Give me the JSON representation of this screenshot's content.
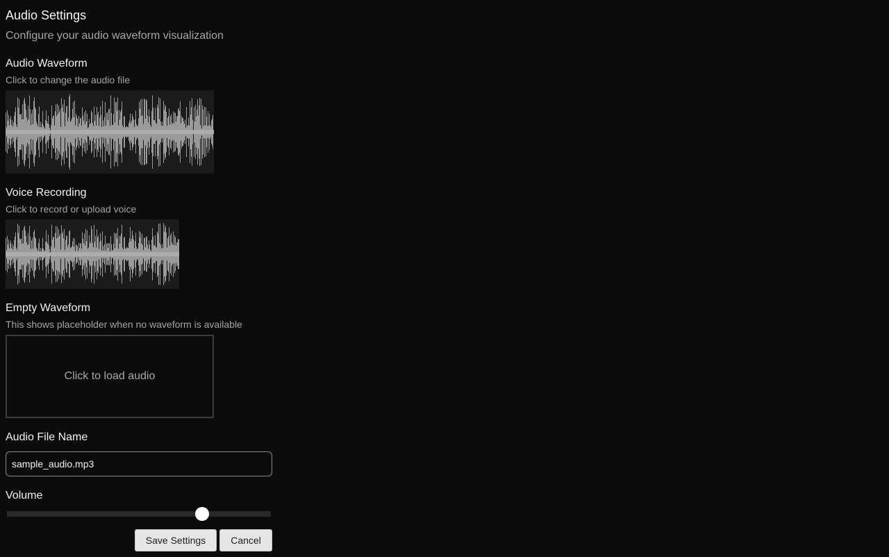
{
  "header": {
    "title": "Audio Settings",
    "subtitle": "Configure your audio waveform visualization"
  },
  "audio_waveform": {
    "label": "Audio Waveform",
    "hint": "Click to change the audio file"
  },
  "voice_recording": {
    "label": "Voice Recording",
    "hint": "Click to record or upload voice"
  },
  "empty_waveform": {
    "label": "Empty Waveform",
    "hint": "This shows placeholder when no waveform is available",
    "placeholder_text": "Click to load audio"
  },
  "file_name": {
    "label": "Audio File Name",
    "value": "sample_audio.mp3"
  },
  "volume": {
    "label": "Volume",
    "value_fraction": 0.74
  },
  "actions": {
    "save_label": "Save Settings",
    "cancel_label": "Cancel"
  },
  "colors": {
    "background": "#0b0b0b",
    "waveform_bg": "#1b1b1b",
    "waveform_stroke": "#9a9a9a",
    "waveform_center": "#d0d0d0",
    "button_bg": "#e6e6e6"
  }
}
